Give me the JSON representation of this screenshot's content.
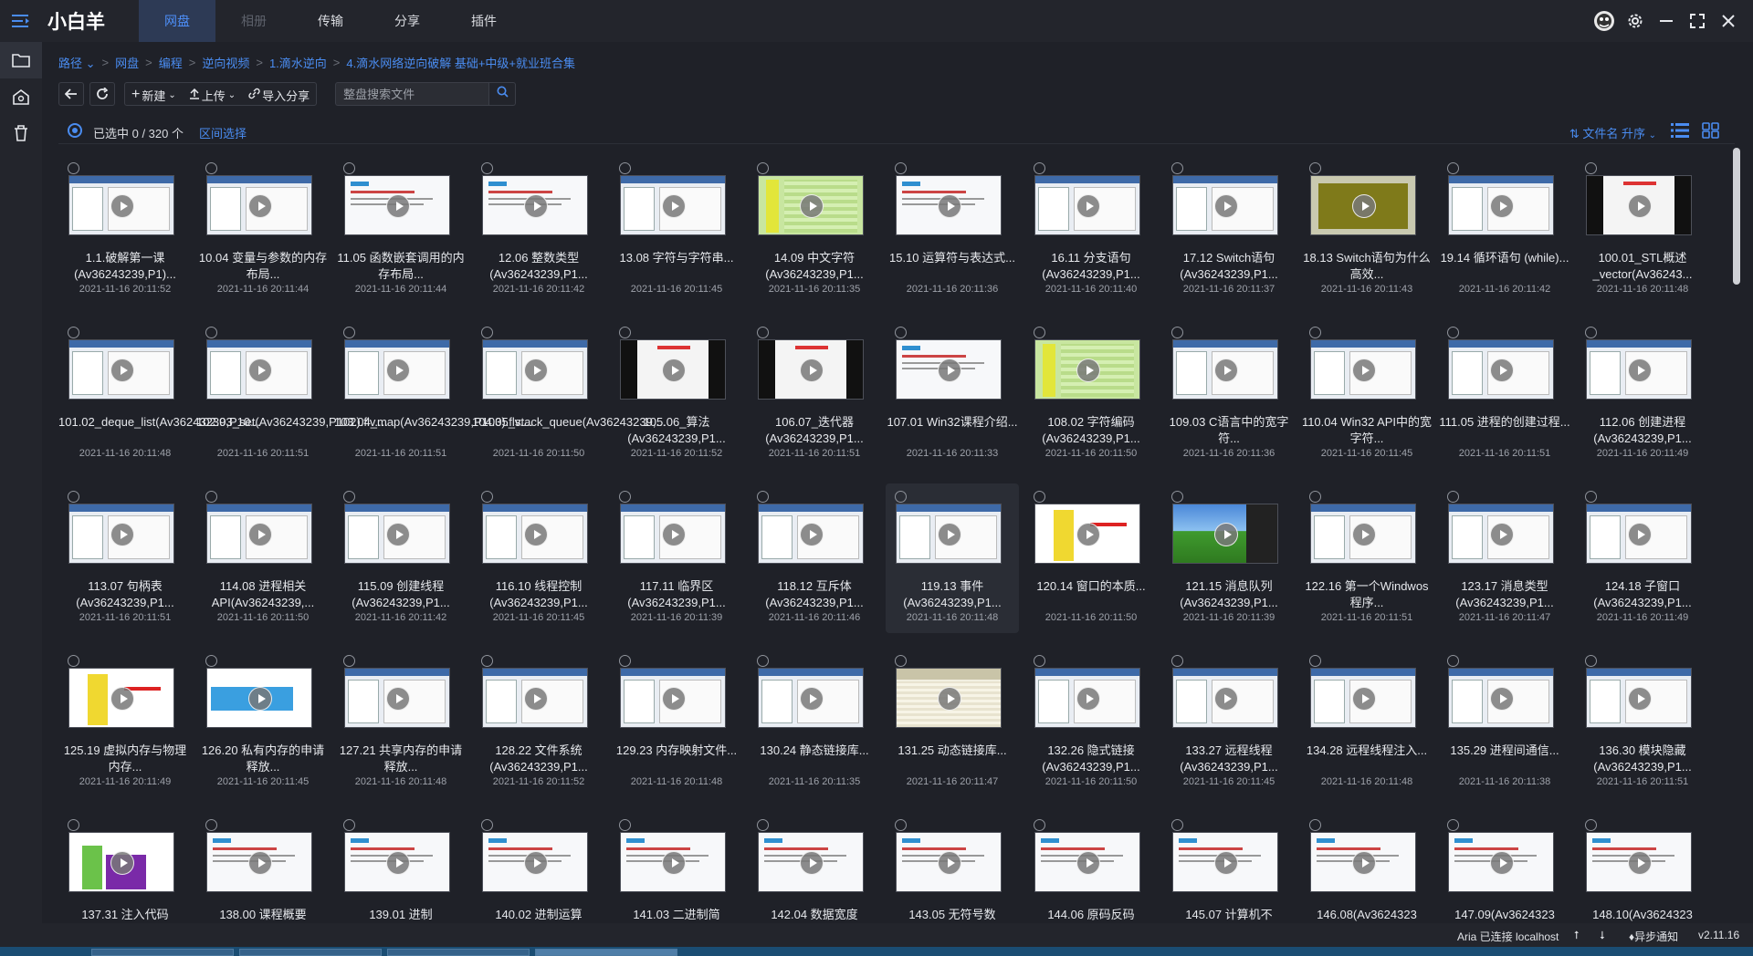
{
  "app": {
    "title": "小白羊"
  },
  "nav": {
    "tabs": [
      {
        "label": "网盘",
        "state": "active"
      },
      {
        "label": "相册",
        "state": "disabled"
      },
      {
        "label": "传输",
        "state": "normal"
      },
      {
        "label": "分享",
        "state": "normal"
      },
      {
        "label": "插件",
        "state": "normal"
      }
    ]
  },
  "window_icons": [
    "avatar-icon",
    "gear-icon",
    "minimize-icon",
    "fullscreen-icon",
    "close-icon"
  ],
  "rail_icons": [
    "folder-icon",
    "album-icon",
    "trash-icon"
  ],
  "breadcrumb": [
    "路径 ⌄",
    "网盘",
    "编程",
    "逆向视频",
    "1.滴水逆向",
    "4.滴水网络逆向破解 基础+中级+就业班合集"
  ],
  "toolbar": {
    "new_label": "新建",
    "upload_label": "上传",
    "import_label": "导入分享",
    "search_placeholder": "整盘搜索文件"
  },
  "status": {
    "selected": "已选中 0 / 320 个",
    "range_select": "区间选择",
    "sort": "文件名 升序"
  },
  "files": [
    {
      "name": "1.1.破解第一课 (Av36243239,P1)...",
      "date": "2021-11-16 20:11:52",
      "style": "win"
    },
    {
      "name": "10.04 变量与参数的内存布局...",
      "date": "2021-11-16 20:11:44",
      "style": "win"
    },
    {
      "name": "11.05 函数嵌套调用的内存布局...",
      "date": "2021-11-16 20:11:44",
      "style": "white"
    },
    {
      "name": "12.06 整数类型 (Av36243239,P1...",
      "date": "2021-11-16 20:11:42",
      "style": "white"
    },
    {
      "name": "13.08 字符与字符串...",
      "date": "2021-11-16 20:11:45",
      "style": "win"
    },
    {
      "name": "14.09 中文字符 (Av36243239,P1...",
      "date": "2021-11-16 20:11:35",
      "style": "green"
    },
    {
      "name": "15.10 运算符与表达式...",
      "date": "2021-11-16 20:11:36",
      "style": "white"
    },
    {
      "name": "16.11 分支语句 (Av36243239,P1...",
      "date": "2021-11-16 20:11:40",
      "style": "win"
    },
    {
      "name": "17.12 Switch语句 (Av36243239,P1...",
      "date": "2021-11-16 20:11:37",
      "style": "win"
    },
    {
      "name": "18.13 Switch语句为什么高效...",
      "date": "2021-11-16 20:11:43",
      "style": "olive"
    },
    {
      "name": "19.14 循环语句 (while)...",
      "date": "2021-11-16 20:11:42",
      "style": "win"
    },
    {
      "name": "100.01_STL概述_vector(Av36243...",
      "date": "2021-11-16 20:11:48",
      "style": "dark"
    },
    {
      "name": "101.02_deque_list(Av36243239,P10...",
      "date": "2021-11-16 20:11:48",
      "style": "win"
    },
    {
      "name": "102.03_set(Av36243239,P102).flv....",
      "date": "2021-11-16 20:11:51",
      "style": "win"
    },
    {
      "name": "103.04_map(Av36243239,P103).flv....",
      "date": "2021-11-16 20:11:51",
      "style": "win"
    },
    {
      "name": "104.05_stack_queue(Av36243239,...",
      "date": "2021-11-16 20:11:50",
      "style": "win"
    },
    {
      "name": "105.06_算法 (Av36243239,P1...",
      "date": "2021-11-16 20:11:52",
      "style": "dark"
    },
    {
      "name": "106.07_迭代器 (Av36243239,P1...",
      "date": "2021-11-16 20:11:51",
      "style": "dark"
    },
    {
      "name": "107.01 Win32课程介绍...",
      "date": "2021-11-16 20:11:33",
      "style": "white"
    },
    {
      "name": "108.02 字符编码 (Av36243239,P1...",
      "date": "2021-11-16 20:11:50",
      "style": "green"
    },
    {
      "name": "109.03 C语言中的宽字符...",
      "date": "2021-11-16 20:11:36",
      "style": "win"
    },
    {
      "name": "110.04 Win32 API中的宽字符...",
      "date": "2021-11-16 20:11:45",
      "style": "win"
    },
    {
      "name": "111.05 进程的创建过程...",
      "date": "2021-11-16 20:11:51",
      "style": "win"
    },
    {
      "name": "112.06 创建进程 (Av36243239,P1...",
      "date": "2021-11-16 20:11:49",
      "style": "win"
    },
    {
      "name": "113.07 句柄表 (Av36243239,P1...",
      "date": "2021-11-16 20:11:51",
      "style": "win"
    },
    {
      "name": "114.08 进程相关API(Av36243239,...",
      "date": "2021-11-16 20:11:50",
      "style": "win"
    },
    {
      "name": "115.09 创建线程 (Av36243239,P1...",
      "date": "2021-11-16 20:11:42",
      "style": "win"
    },
    {
      "name": "116.10 线程控制 (Av36243239,P1...",
      "date": "2021-11-16 20:11:45",
      "style": "win"
    },
    {
      "name": "117.11 临界区 (Av36243239,P1...",
      "date": "2021-11-16 20:11:39",
      "style": "win"
    },
    {
      "name": "118.12 互斥体 (Av36243239,P1...",
      "date": "2021-11-16 20:11:46",
      "style": "win"
    },
    {
      "name": "119.13 事件 (Av36243239,P1...",
      "date": "2021-11-16 20:11:48",
      "style": "win"
    },
    {
      "name": "120.14 窗口的本质...",
      "date": "2021-11-16 20:11:50",
      "style": "yellow"
    },
    {
      "name": "121.15 消息队列 (Av36243239,P1...",
      "date": "2021-11-16 20:11:39",
      "style": "xp"
    },
    {
      "name": "122.16 第一个Windwos程序...",
      "date": "2021-11-16 20:11:51",
      "style": "win"
    },
    {
      "name": "123.17 消息类型 (Av36243239,P1...",
      "date": "2021-11-16 20:11:47",
      "style": "win"
    },
    {
      "name": "124.18 子窗口 (Av36243239,P1...",
      "date": "2021-11-16 20:11:49",
      "style": "win"
    },
    {
      "name": "125.19 虚拟内存与物理内存...",
      "date": "2021-11-16 20:11:49",
      "style": "yellow"
    },
    {
      "name": "126.20 私有内存的申请释放...",
      "date": "2021-11-16 20:11:45",
      "style": "blue"
    },
    {
      "name": "127.21 共享内存的申请释放...",
      "date": "2021-11-16 20:11:48",
      "style": "win"
    },
    {
      "name": "128.22 文件系统 (Av36243239,P1...",
      "date": "2021-11-16 20:11:52",
      "style": "win"
    },
    {
      "name": "129.23 内存映射文件...",
      "date": "2021-11-16 20:11:48",
      "style": "win"
    },
    {
      "name": "130.24 静态链接库...",
      "date": "2021-11-16 20:11:35",
      "style": "win"
    },
    {
      "name": "131.25 动态链接库...",
      "date": "2021-11-16 20:11:47",
      "style": "beige"
    },
    {
      "name": "132.26 隐式链接 (Av36243239,P1...",
      "date": "2021-11-16 20:11:50",
      "style": "win"
    },
    {
      "name": "133.27 远程线程 (Av36243239,P1...",
      "date": "2021-11-16 20:11:45",
      "style": "win"
    },
    {
      "name": "134.28 远程线程注入...",
      "date": "2021-11-16 20:11:48",
      "style": "win"
    },
    {
      "name": "135.29 进程间通信...",
      "date": "2021-11-16 20:11:38",
      "style": "win"
    },
    {
      "name": "136.30 模块隐藏 (Av36243239,P1...",
      "date": "2021-11-16 20:11:51",
      "style": "win"
    },
    {
      "name": "137.31 注入代码",
      "date": "",
      "style": "purple"
    },
    {
      "name": "138.00 课程概要",
      "date": "",
      "style": "white"
    },
    {
      "name": "139.01 进制",
      "date": "",
      "style": "white"
    },
    {
      "name": "140.02 进制运算",
      "date": "",
      "style": "white"
    },
    {
      "name": "141.03 二进制简",
      "date": "",
      "style": "white"
    },
    {
      "name": "142.04 数据宽度",
      "date": "",
      "style": "white"
    },
    {
      "name": "143.05 无符号数",
      "date": "",
      "style": "white"
    },
    {
      "name": "144.06 原码反码",
      "date": "",
      "style": "white"
    },
    {
      "name": "145.07 计算机不",
      "date": "",
      "style": "white"
    },
    {
      "name": "146.08(Av3624323",
      "date": "",
      "style": "white"
    },
    {
      "name": "147.09(Av3624323",
      "date": "",
      "style": "white"
    },
    {
      "name": "148.10(Av3624323",
      "date": "",
      "style": "white"
    }
  ],
  "bottom": {
    "aria": "Aria 已连接 localhost",
    "notify": "异步通知",
    "version": "v2.11.16"
  },
  "colors": {
    "accent": "#4a8cf0",
    "background": "#1f2128"
  }
}
